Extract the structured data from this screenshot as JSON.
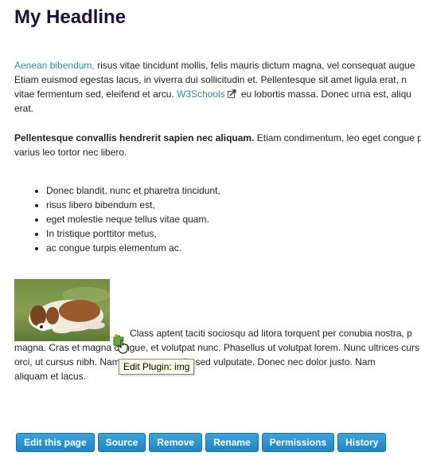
{
  "page": {
    "headline": "My Headline"
  },
  "paragraph1": {
    "link1": "Aenean bibendum,",
    "text1": " risus vitae tincidunt mollis, felis mauris dictum magna, vel consequat augue",
    "line2": "Etiam euismod egestas lacus, in viverra dui sollicitudin et. Pellentesque sit amet ligula erat, n",
    "text3a": "vitae fermentum sed, eleifend et arcu. ",
    "link2": "W3Schools",
    "text3b": "eu lobortis massa. Donec urna est, aliqu",
    "line4": "erat."
  },
  "paragraph2": {
    "bold": "Pellentesque convallis hendrerit sapien nec aliquam.",
    "text1": " Etiam condimentum, leo eget congue p",
    "line2": "varius leo tortor nec libero."
  },
  "bullets": [
    "Donec blandit, nunc et pharetra tincidunt,",
    "risus libero bibendum est,",
    "eget molestie neque tellus vitae quam.",
    "In tristique porttitor metus,",
    "ac congue turpis elementum ac."
  ],
  "paragraph3": {
    "line1": "Class aptent taciti sociosqu ad litora torquent per conubia nostra, p",
    "line2": "magna. Cras et magna congue, et volutpat nunc. Phasellus ut volutpat lorem. Nunc ultrices curs",
    "line3": "orci, ut cursus nibh. Nam consectetur odio sed vulputate. Donec nec dolor justo. Nam",
    "line4": "aliquam et lacus."
  },
  "tooltip": "Edit Plugin: img",
  "toolbar": {
    "edit": "Edit this page",
    "source": "Source",
    "remove": "Remove",
    "rename": "Rename",
    "permissions": "Permissions",
    "history": "History"
  },
  "colors": {
    "headline": "#1f0e3e",
    "link": "#2a8fb5",
    "button": "#2390cf"
  },
  "icons": {
    "external_link": "external-link-icon",
    "plugin": "puzzle-plugin-icon",
    "cursor": "hand-cursor-icon"
  }
}
